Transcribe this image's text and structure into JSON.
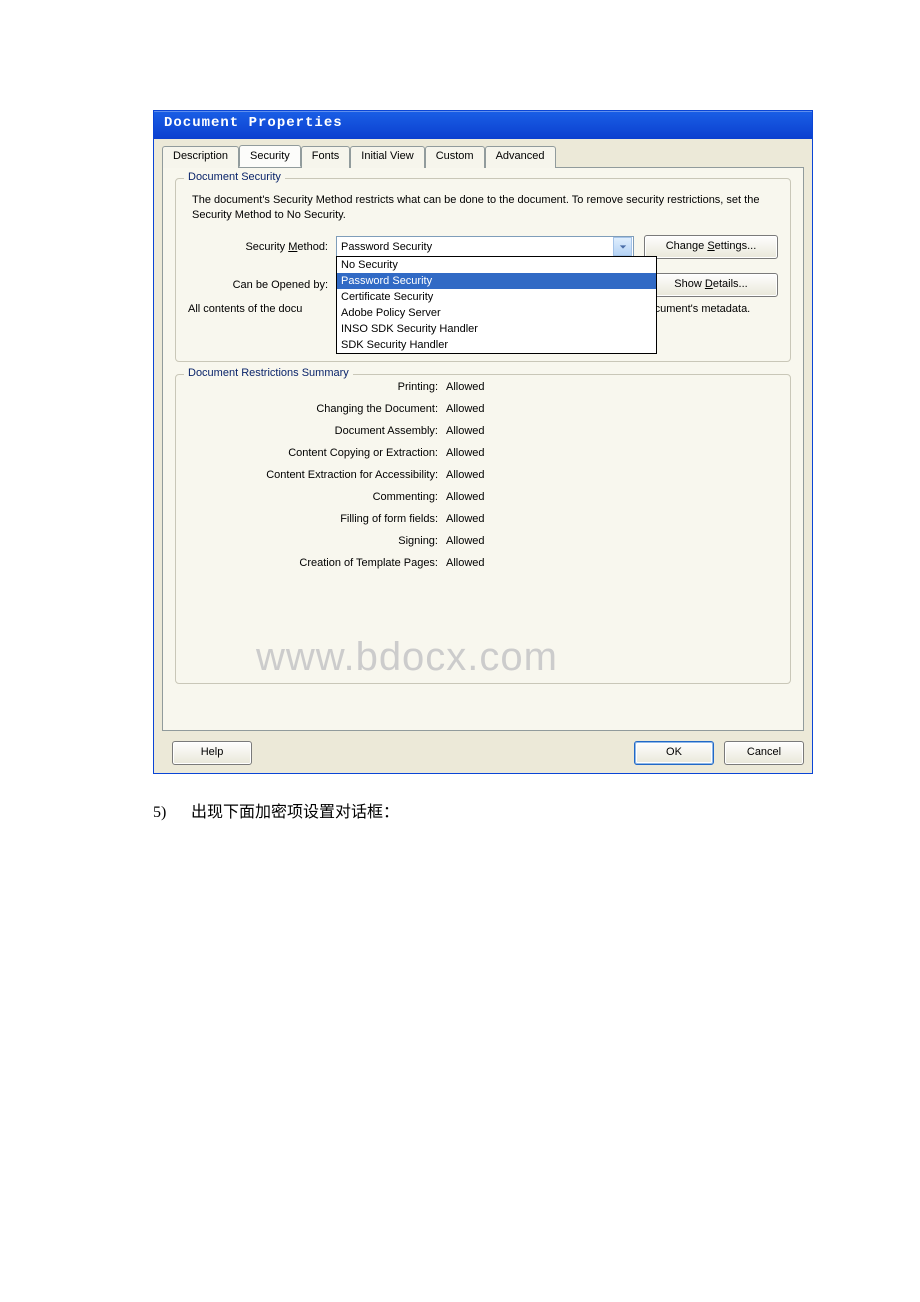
{
  "dialog": {
    "title": "Document Properties"
  },
  "tabs": [
    "Description",
    "Security",
    "Fonts",
    "Initial View",
    "Custom",
    "Advanced"
  ],
  "active_tab_index": 1,
  "security_group": {
    "legend": "Document Security",
    "description": "The document's Security Method restricts what can be done to the document. To remove security restrictions, set the Security Method to No Security.",
    "method_label": "Security Method:",
    "method_value": "Password Security",
    "options": [
      "No Security",
      "Password Security",
      "Certificate Security",
      "Adobe Policy Server",
      "INSO SDK Security Handler",
      "SDK Security Handler"
    ],
    "selected_option_index": 1,
    "opened_by_label": "Can be Opened by:",
    "all_contents_label": "All contents of the docu",
    "metadata_tail": "document's metadata.",
    "change_settings": "Change Settings...",
    "show_details": "Show Details..."
  },
  "restrictions": {
    "legend": "Document Restrictions Summary",
    "rows": [
      {
        "label": "Printing:",
        "value": "Allowed"
      },
      {
        "label": "Changing the Document:",
        "value": "Allowed"
      },
      {
        "label": "Document Assembly:",
        "value": "Allowed"
      },
      {
        "label": "Content Copying or Extraction:",
        "value": "Allowed"
      },
      {
        "label": "Content Extraction for Accessibility:",
        "value": "Allowed"
      },
      {
        "label": "Commenting:",
        "value": "Allowed"
      },
      {
        "label": "Filling of form fields:",
        "value": "Allowed"
      },
      {
        "label": "Signing:",
        "value": "Allowed"
      },
      {
        "label": "Creation of Template Pages:",
        "value": "Allowed"
      }
    ]
  },
  "buttons": {
    "help": "Help",
    "ok": "OK",
    "cancel": "Cancel"
  },
  "watermark": "www.bdocx.com",
  "caption": {
    "num": "5)",
    "text": "出现下面加密项设置对话框："
  }
}
